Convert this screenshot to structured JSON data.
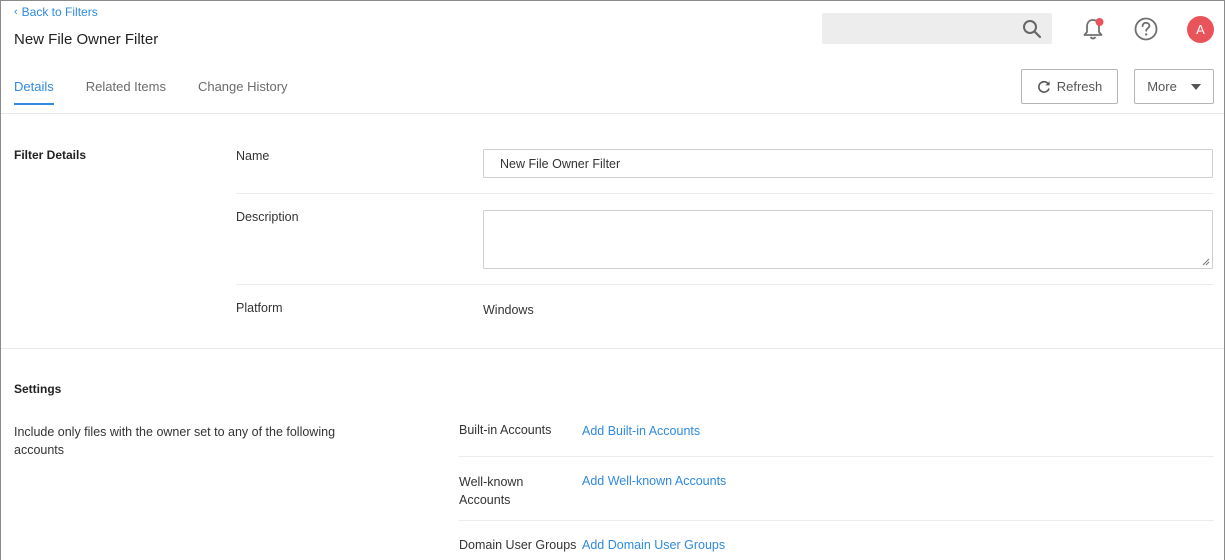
{
  "header": {
    "back_label": "Back to Filters",
    "title": "New File Owner Filter",
    "search_placeholder": "",
    "avatar_initial": "A"
  },
  "tabs": [
    {
      "label": "Details",
      "active": true
    },
    {
      "label": "Related Items",
      "active": false
    },
    {
      "label": "Change History",
      "active": false
    }
  ],
  "actions": {
    "refresh_label": "Refresh",
    "more_label": "More"
  },
  "filter_details": {
    "section_title": "Filter Details",
    "name_label": "Name",
    "name_value": "New File Owner Filter",
    "description_label": "Description",
    "description_value": "",
    "platform_label": "Platform",
    "platform_value": "Windows"
  },
  "settings": {
    "section_title": "Settings",
    "description": "Include only files with the owner set to any of the following accounts",
    "rows": [
      {
        "label": "Built-in Accounts",
        "link": "Add Built-in Accounts"
      },
      {
        "label": "Well-known Accounts",
        "link": "Add Well-known Accounts"
      },
      {
        "label": "Domain User Groups",
        "link": "Add Domain User Groups"
      }
    ]
  },
  "colors": {
    "accent": "#2f8ae0",
    "avatar": "#e9545a",
    "notification_dot": "#e9545a"
  }
}
